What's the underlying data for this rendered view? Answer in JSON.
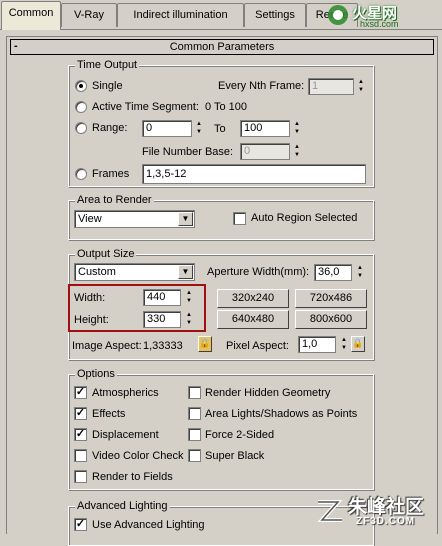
{
  "tabs": [
    "Common",
    "V-Ray",
    "Indirect illumination",
    "Settings",
    "Rende"
  ],
  "logo_text": "火星网",
  "logo_sub": "hxsd.com",
  "rollout_title": "Common Parameters",
  "rollout_toggle": "-",
  "time_output": {
    "label": "Time Output",
    "single": "Single",
    "every_nth": "Every Nth Frame:",
    "every_nth_value": "1",
    "active_segment": "Active Time Segment:",
    "active_range": "0 To 100",
    "range": "Range:",
    "range_from": "0",
    "range_to_label": "To",
    "range_to": "100",
    "file_number_base": "File Number Base:",
    "file_number_value": "0",
    "frames": "Frames",
    "frames_value": "1,3,5-12"
  },
  "area_to_render": {
    "label": "Area to Render",
    "selected": "View",
    "auto_region": "Auto Region Selected"
  },
  "output_size": {
    "label": "Output Size",
    "preset": "Custom",
    "aperture_label": "Aperture Width(mm):",
    "aperture_value": "36,0",
    "width_label": "Width:",
    "width_value": "440",
    "height_label": "Height:",
    "height_value": "330",
    "presets": [
      "320x240",
      "720x486",
      "640x480",
      "800x600"
    ],
    "image_aspect_label": "Image Aspect:",
    "image_aspect_value": "1,33333",
    "pixel_aspect_label": "Pixel Aspect:",
    "pixel_aspect_value": "1,0"
  },
  "options": {
    "label": "Options",
    "items": [
      {
        "label": "Atmospherics",
        "checked": true
      },
      {
        "label": "Render Hidden Geometry",
        "checked": false
      },
      {
        "label": "Effects",
        "checked": true
      },
      {
        "label": "Area Lights/Shadows as Points",
        "checked": false
      },
      {
        "label": "Displacement",
        "checked": true
      },
      {
        "label": "Force 2-Sided",
        "checked": false
      },
      {
        "label": "Video Color Check",
        "checked": false
      },
      {
        "label": "Super Black",
        "checked": false
      },
      {
        "label": "Render to Fields",
        "checked": false
      }
    ]
  },
  "advanced_lighting": {
    "label": "Advanced Lighting",
    "use_label": "Use Advanced Lighting",
    "use_checked": true
  },
  "watermark": {
    "text": "朱峰社区",
    "sub": "ZF3D.COM"
  },
  "colors": {
    "accent_red": "#a01010",
    "panel_bg": "#d4d0c8"
  }
}
